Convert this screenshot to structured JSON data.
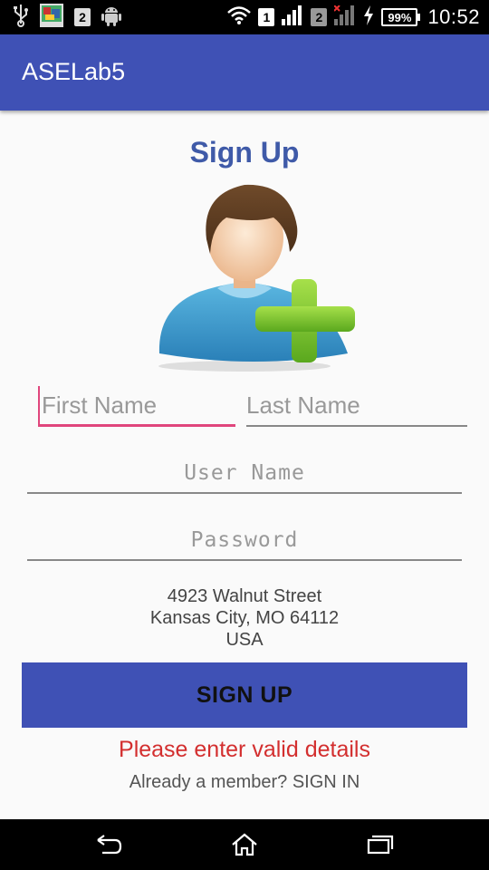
{
  "status_bar": {
    "left_icons": [
      "usb-icon",
      "gallery-thumbnail-icon",
      "notification-2-icon",
      "android-icon"
    ],
    "notification_count": "2",
    "sim1_label": "1",
    "sim2_label": "2",
    "battery_percent": "99%",
    "time": "10:52"
  },
  "app_bar": {
    "title": "ASELab5"
  },
  "main": {
    "title": "Sign Up",
    "avatar_icon": "add-user-icon",
    "first_name_placeholder": "First Name",
    "last_name_placeholder": "Last Name",
    "user_name_placeholder": "User Name",
    "password_placeholder": "Password",
    "address": {
      "line1": "4923 Walnut Street",
      "line2": "Kansas City, MO 64112",
      "line3": "USA"
    },
    "signup_button_label": "SIGN UP",
    "error_message": "Please enter valid details",
    "signin_text": "Already a member? SIGN IN"
  },
  "colors": {
    "primary": "#3f51b5",
    "title_text": "#3f5aa8",
    "accent": "#e0467c",
    "error": "#d32f2f"
  },
  "nav_bar": {
    "icons": [
      "back-icon",
      "home-icon",
      "recent-apps-icon"
    ]
  }
}
